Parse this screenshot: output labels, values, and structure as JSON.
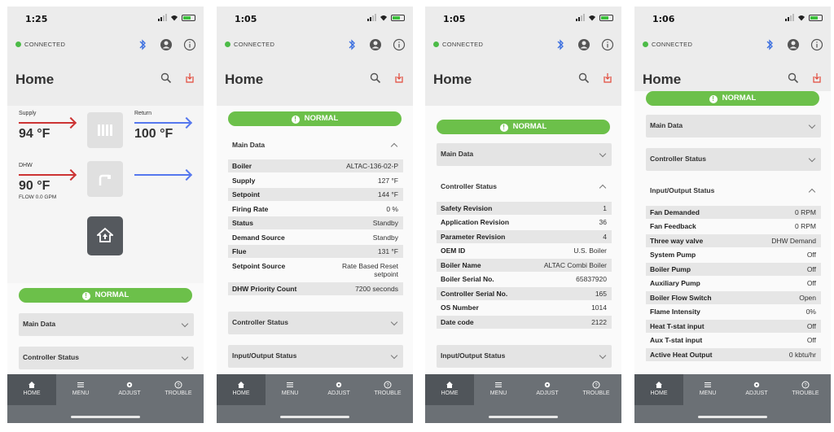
{
  "status": {
    "p1_time": "1:25",
    "p2_time": "1:05",
    "p3_time": "1:05",
    "p4_time": "1:06",
    "connected": "CONNECTED"
  },
  "header": {
    "title": "Home"
  },
  "badge": {
    "normal": "NORMAL"
  },
  "colors": {
    "normal": "#6cc04a",
    "supply_arrow": "#cc3333",
    "return_arrow": "#5577ee",
    "bluetooth": "#3b6fe0",
    "power": "#e24a3b"
  },
  "icons": [
    "bluetooth-icon",
    "user-icon",
    "info-icon",
    "search-icon",
    "power-icon",
    "radiator-icon",
    "faucet-icon",
    "home-icon"
  ],
  "home_screen": {
    "supply_label": "Supply",
    "supply_value": "94 °F",
    "return_label": "Return",
    "return_value": "100 °F",
    "dhw_label": "DHW",
    "dhw_value": "90 °F",
    "flow": "FLOW 0.0 GPM"
  },
  "sections": {
    "main_data": "Main Data",
    "controller_status": "Controller Status",
    "io_status": "Input/Output Status"
  },
  "main_data": [
    {
      "k": "Boiler",
      "v": "ALTAC-136-02-P"
    },
    {
      "k": "Supply",
      "v": "127 °F"
    },
    {
      "k": "Setpoint",
      "v": "144 °F"
    },
    {
      "k": "Firing Rate",
      "v": "0 %"
    },
    {
      "k": "Status",
      "v": "Standby"
    },
    {
      "k": "Demand Source",
      "v": "Standby"
    },
    {
      "k": "Flue",
      "v": "131 °F"
    },
    {
      "k": "Setpoint Source",
      "v": "Rate Based Reset setpoint"
    },
    {
      "k": "DHW Priority Count",
      "v": "7200 seconds"
    }
  ],
  "controller_status": [
    {
      "k": "Safety Revision",
      "v": "1"
    },
    {
      "k": "Application Revision",
      "v": "36"
    },
    {
      "k": "Parameter Revision",
      "v": "4"
    },
    {
      "k": "OEM ID",
      "v": "U.S. Boiler"
    },
    {
      "k": "Boiler Name",
      "v": "ALTAC Combi Boiler"
    },
    {
      "k": "Boiler Serial No.",
      "v": "65837920"
    },
    {
      "k": "Controller Serial No.",
      "v": "165"
    },
    {
      "k": "OS Number",
      "v": "1014"
    },
    {
      "k": "Date code",
      "v": "2122"
    }
  ],
  "io_status": [
    {
      "k": "Fan Demanded",
      "v": "0 RPM"
    },
    {
      "k": "Fan Feedback",
      "v": "0 RPM"
    },
    {
      "k": "Three way valve",
      "v": "DHW Demand"
    },
    {
      "k": "System Pump",
      "v": "Off"
    },
    {
      "k": "Boiler Pump",
      "v": "Off"
    },
    {
      "k": "Auxiliary Pump",
      "v": "Off"
    },
    {
      "k": "Boiler Flow Switch",
      "v": "Open"
    },
    {
      "k": "Flame Intensity",
      "v": "0%"
    },
    {
      "k": "Heat T-stat input",
      "v": "Off"
    },
    {
      "k": "Aux T-stat input",
      "v": "Off"
    },
    {
      "k": "Active Heat Output",
      "v": "0 kbtu/hr"
    }
  ],
  "tabs": [
    "HOME",
    "MENU",
    "ADJUST",
    "TROUBLE"
  ]
}
